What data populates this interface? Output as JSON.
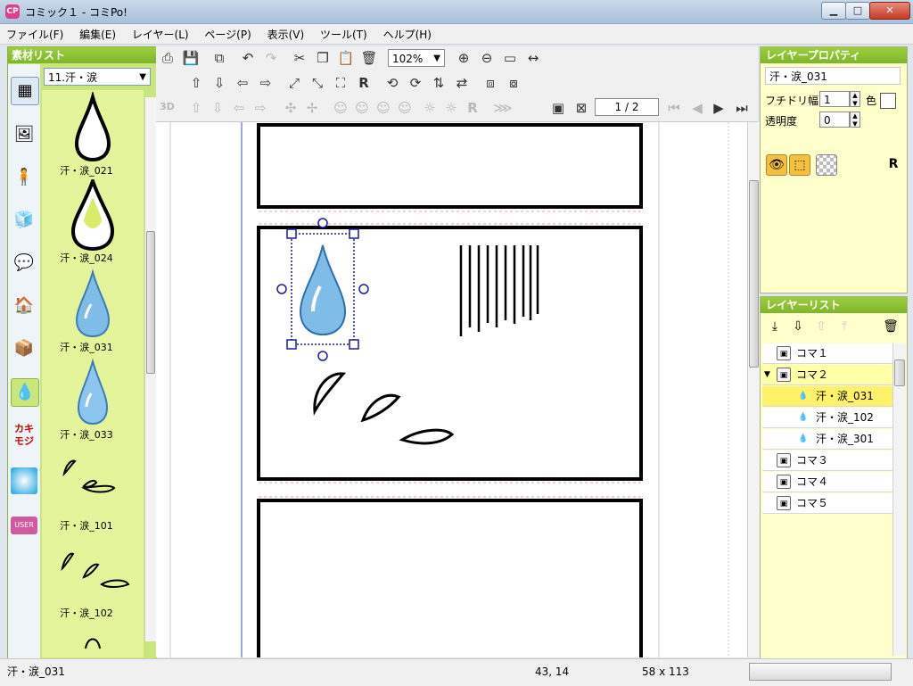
{
  "window": {
    "title": "コミック１ - コミPo!",
    "app_icon": "CP",
    "min_glyph": "▁",
    "max_glyph": "□",
    "close_glyph": "✕"
  },
  "menu": [
    "ファイル(F)",
    "編集(E)",
    "レイヤー(L)",
    "ページ(P)",
    "表示(V)",
    "ツール(T)",
    "ヘルプ(H)"
  ],
  "materials": {
    "title": "素材リスト",
    "category": "11.汗・涙",
    "items": [
      {
        "label": "汗・涙_021",
        "icon": "drop-outline-icon"
      },
      {
        "label": "汗・涙_024",
        "icon": "drop-outline-yellow-icon"
      },
      {
        "label": "汗・涙_031",
        "icon": "drop-blue-icon"
      },
      {
        "label": "汗・涙_033",
        "icon": "drop-blue-icon"
      },
      {
        "label": "汗・涙_101",
        "icon": "sweat-strokes-icon"
      },
      {
        "label": "汗・涙_102",
        "icon": "sweat-strokes-icon"
      }
    ],
    "categories": [
      {
        "icon": "panel-grid-icon"
      },
      {
        "icon": "background-icon"
      },
      {
        "icon": "3d-character-icon"
      },
      {
        "icon": "3d-object-icon"
      },
      {
        "icon": "speech-bubble-icon"
      },
      {
        "icon": "building-image-icon"
      },
      {
        "icon": "cube-icon"
      },
      {
        "icon": "sweat-drop-icon"
      },
      {
        "icon": "kakimoji-icon"
      },
      {
        "icon": "effect-burst-icon"
      },
      {
        "icon": "user-folder-icon"
      }
    ]
  },
  "toolbar": {
    "zoom": "102%",
    "page": "1 / 2",
    "label_3d": "3D"
  },
  "properties": {
    "title": "レイヤープロパティ",
    "name": "汗・涙_031",
    "outline_label": "フチドリ幅",
    "outline_value": "1",
    "color_label": "色",
    "opacity_label": "透明度",
    "opacity_value": "0",
    "r_label": "R"
  },
  "layers": {
    "title": "レイヤーリスト",
    "rows": [
      {
        "label": "コマ１",
        "indent": 0,
        "state": "normal"
      },
      {
        "label": "コマ２",
        "indent": 0,
        "state": "parent"
      },
      {
        "label": "汗・涙_031",
        "indent": 1,
        "state": "selected"
      },
      {
        "label": "汗・涙_102",
        "indent": 1,
        "state": "normal"
      },
      {
        "label": "汗・涙_301",
        "indent": 1,
        "state": "normal"
      },
      {
        "label": "コマ３",
        "indent": 0,
        "state": "normal"
      },
      {
        "label": "コマ４",
        "indent": 0,
        "state": "normal"
      },
      {
        "label": "コマ５",
        "indent": 0,
        "state": "normal"
      }
    ]
  },
  "status": {
    "name": "汗・涙_031",
    "position": "43, 14",
    "size": "58 x 113"
  }
}
